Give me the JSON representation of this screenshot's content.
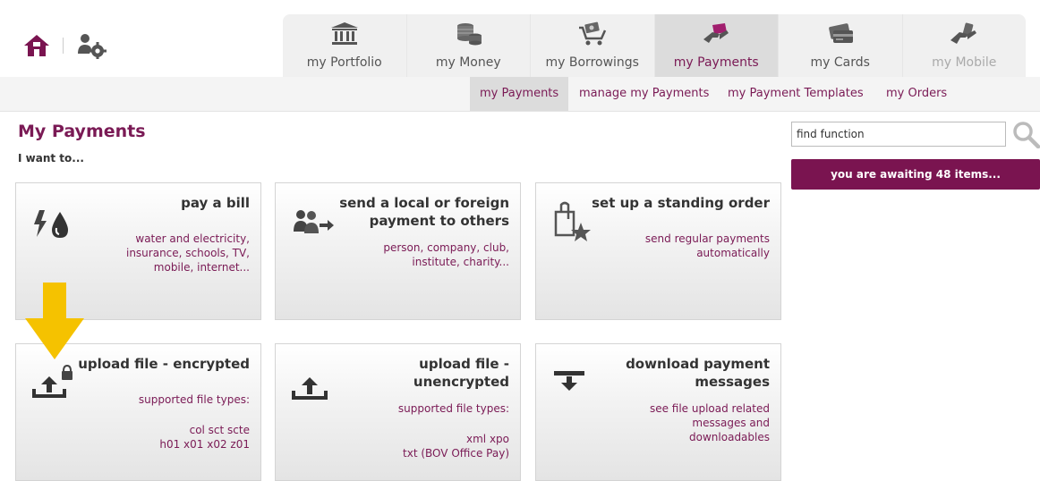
{
  "tabs": [
    {
      "label": "my Portfolio",
      "icon": "bank-icon"
    },
    {
      "label": "my Money",
      "icon": "coins-icon"
    },
    {
      "label": "my Borrowings",
      "icon": "cart-icon"
    },
    {
      "label": "my Payments",
      "icon": "payment-hand-icon",
      "active": true
    },
    {
      "label": "my Cards",
      "icon": "cards-icon"
    },
    {
      "label": "my Mobile",
      "icon": "mobile-hand-icon"
    }
  ],
  "subnav": [
    {
      "label": "my Payments",
      "active": true
    },
    {
      "label": "manage my Payments"
    },
    {
      "label": "my Payment Templates"
    },
    {
      "label": "my Orders"
    }
  ],
  "page": {
    "title": "My Payments",
    "subtitle": "I want to..."
  },
  "search": {
    "value": "find function",
    "awaiting_label": "you are awaiting 48 items..."
  },
  "cards": [
    {
      "title_lines": [
        "pay a bill"
      ],
      "desc_lines": [
        "water and electricity,",
        "insurance, schools, TV,",
        "mobile, internet..."
      ]
    },
    {
      "title_lines": [
        "send a local or foreign",
        "payment to others"
      ],
      "desc_lines": [
        "person, company, club,",
        "institute, charity..."
      ]
    },
    {
      "title_lines": [
        "set up a standing order"
      ],
      "desc_lines": [
        "send regular payments",
        "automatically"
      ]
    },
    {
      "title_lines": [
        "upload file - encrypted"
      ],
      "desc_lines": [
        "supported file types:"
      ],
      "desc2_lines": [
        "col sct scte",
        "h01 x01 x02 z01"
      ]
    },
    {
      "title_lines": [
        "upload file -",
        "unencrypted"
      ],
      "desc_lines": [
        "supported file types:"
      ],
      "desc2_lines": [
        "xml xpo",
        "txt (BOV Office Pay)"
      ]
    },
    {
      "title_lines": [
        "download payment",
        "messages"
      ],
      "desc_lines": [
        "see file upload related",
        "messages and",
        "downloadables"
      ]
    }
  ],
  "colors": {
    "brand": "#7a1a55",
    "annotation_arrow": "#f5c200"
  }
}
